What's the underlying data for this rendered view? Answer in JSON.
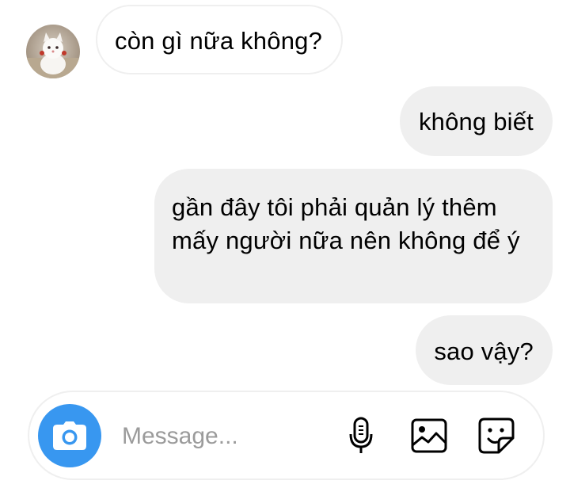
{
  "thread": {
    "messages": [
      {
        "direction": "incoming",
        "text": "còn gì nữa không?"
      },
      {
        "direction": "outgoing",
        "text": "không biết"
      },
      {
        "direction": "outgoing",
        "text": "gần đây tôi phải quản lý thêm mấy người nữa nên không để ý"
      },
      {
        "direction": "outgoing",
        "text": "sao vậy?"
      }
    ]
  },
  "composer": {
    "placeholder": "Message...",
    "icons": [
      "camera-icon",
      "microphone-icon",
      "gallery-icon",
      "sticker-icon"
    ]
  },
  "colors": {
    "accent": "#3897f0",
    "outgoing_bubble": "#efefef",
    "incoming_border": "#efefef",
    "placeholder": "#9b9b9b"
  }
}
